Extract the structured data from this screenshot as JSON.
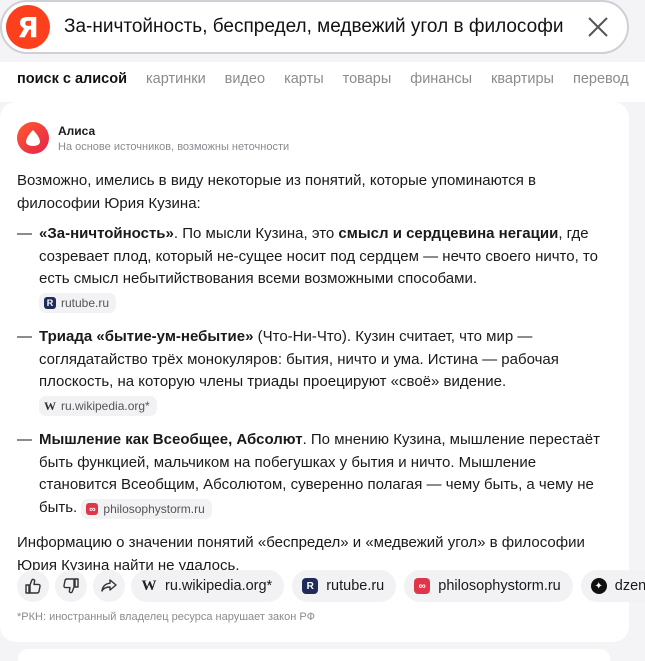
{
  "search": {
    "logo_letter": "Я",
    "query": "За-ничтойность, беспредел, медвежий угол в философи…"
  },
  "tabs": [
    "поиск с алисой",
    "картинки",
    "видео",
    "карты",
    "товары",
    "финансы",
    "квартиры",
    "перевод"
  ],
  "alice": {
    "name": "Алиса",
    "subtitle": "На основе источников, возможны неточности"
  },
  "answer": {
    "intro": "Возможно, имелись в виду некоторые из понятий, которые упоминаются в философии Юрия Кузина:",
    "items": [
      {
        "dash": "—",
        "bold": "«За-ничтойность»",
        "text1": ". По мысли Кузина, это ",
        "bold2": "смысл и сердцевина негации",
        "text2": ", где созревает плод, который не-сущее носит под сердцем — нечто своего ничто, то есть смысл небытийствования всеми возможными способами.",
        "source": "rutube.ru"
      },
      {
        "dash": "—",
        "bold": "Триада «бытие-ум-небытие»",
        "text1": " (Что-Ни-Что). Кузин считает, что мир — соглядатайство трёх монокуляров: бытия, ничто и ума. Истина — рабочая плоскость, на которую члены триады проецируют «своё» видение.",
        "source": "ru.wikipedia.org*"
      },
      {
        "dash": "—",
        "bold": "Мышление как Всеобщее, Абсолют",
        "text1": ". По мнению Кузина, мышление перестаёт быть функцией, мальчиком на побегушках у бытия и ничто. Мышление становится Всеобщим, Абсолютом, суверенно полагая — чему быть, а чему не быть.",
        "source": "philosophystorm.ru"
      }
    ],
    "outro": "Информацию о значении понятий «беспредел» и «медвежий угол» в философии Юрия Кузина найти не удалось."
  },
  "sources": [
    {
      "label": "ru.wikipedia.org*",
      "icon": "W"
    },
    {
      "label": "rutube.ru",
      "icon": "R"
    },
    {
      "label": "philosophystorm.ru",
      "icon": "∞"
    },
    {
      "label": "dzen",
      "icon": "✦"
    }
  ],
  "footnote": "*РКН: иностранный владелец ресурса нарушает закон РФ",
  "colors": {
    "brand": "#fc3f1d",
    "rutube": "#1e2b5b",
    "philosophystorm": "#e0364a"
  }
}
